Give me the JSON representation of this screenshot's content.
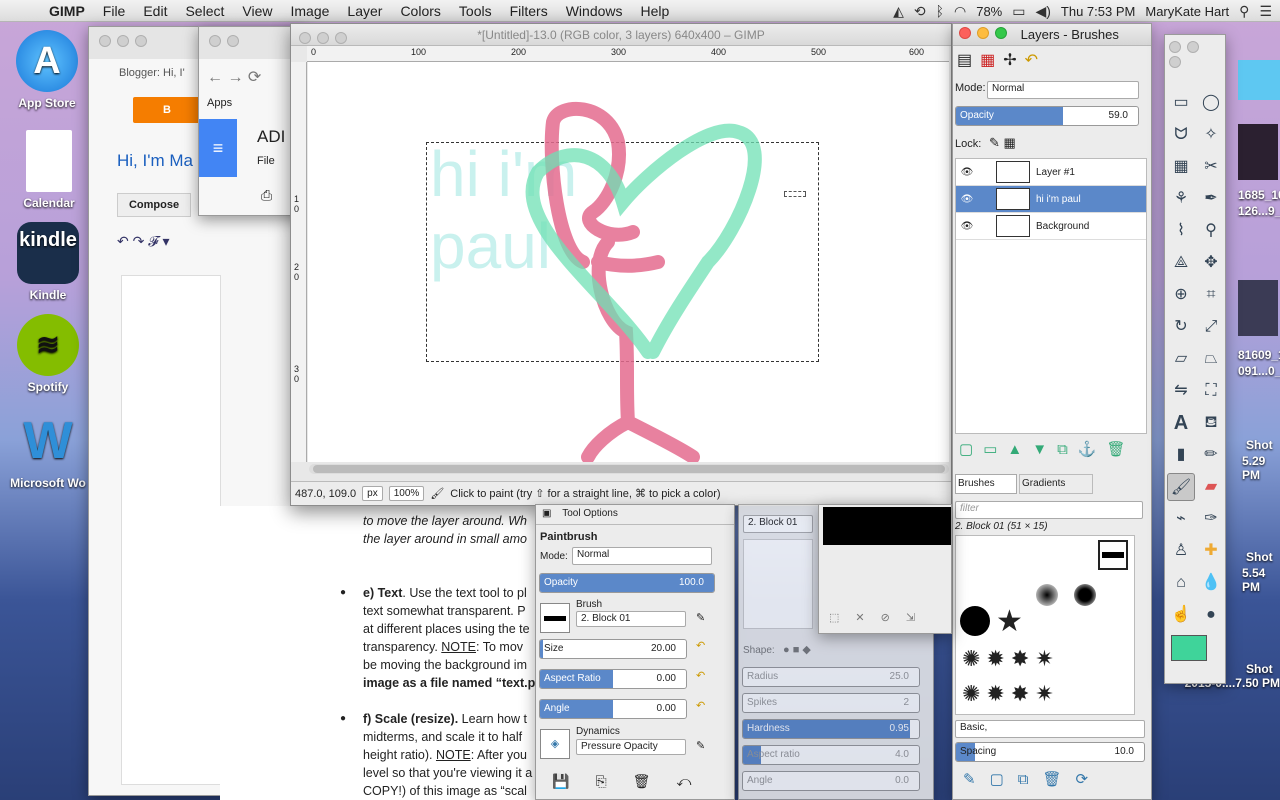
{
  "menubar": {
    "app": "GIMP",
    "items": [
      "File",
      "Edit",
      "Select",
      "View",
      "Image",
      "Layer",
      "Colors",
      "Tools",
      "Filters",
      "Windows",
      "Help"
    ],
    "battery": "78%",
    "clock": "Thu 7:53 PM",
    "user": "MaryKate Hart"
  },
  "desktop": {
    "icons": [
      {
        "label": "App Store"
      },
      {
        "label": "Calendar"
      },
      {
        "label": "Kindle"
      },
      {
        "label": "Spotify"
      },
      {
        "label": "Microsoft Wo"
      }
    ],
    "right_labels": [
      "1685_102",
      "126...9_n",
      "81609_10",
      "091...0_n",
      "Shot",
      "5.29 PM",
      "Shot",
      "5.54 PM",
      "Shot",
      "2015-0....7.50 PM",
      "PM",
      "PM",
      "PM",
      "PM"
    ]
  },
  "browser": {
    "tab_blogger": "Blogger: Hi, I'",
    "greeting": "Hi, I'm Ma",
    "compose": "Compose",
    "apps": "Apps",
    "doc_title": "ADI",
    "doc_menu_file": "File"
  },
  "gimp": {
    "title": "*[Untitled]-13.0 (RGB color, 3 layers) 640x400 – GIMP",
    "ruler_h": [
      "0",
      "100",
      "200",
      "300",
      "400",
      "500",
      "600"
    ],
    "ruler_v": [
      "0",
      "1",
      "0",
      "2",
      "0",
      "3",
      "0"
    ],
    "canvas_text": [
      "hi i'm",
      "paul"
    ],
    "status": {
      "coords": "487.0, 109.0",
      "unit": "px",
      "zoom": "100%",
      "hint": "Click to paint (try ⇧ for a straight line, ⌘ to pick a color)"
    }
  },
  "layers": {
    "title": "Layers - Brushes",
    "mode_label": "Mode:",
    "mode": "Normal",
    "opacity_label": "Opacity",
    "opacity": "59.0",
    "lock": "Lock:",
    "rows": [
      {
        "name": "Layer #1"
      },
      {
        "name": "hi i'm paul"
      },
      {
        "name": "Background"
      }
    ]
  },
  "brushes": {
    "tab1": "Brushes",
    "tab2": "Gradients",
    "filter": "filter",
    "current": "2. Block 01 (51 × 15)",
    "preset": "Basic,",
    "spacing_label": "Spacing",
    "spacing": "10.0"
  },
  "tool_options": {
    "title": "Tool Options",
    "tool": "Paintbrush",
    "mode_label": "Mode:",
    "mode": "Normal",
    "opacity_label": "Opacity",
    "opacity": "100.0",
    "brush_label": "Brush",
    "brush": "2. Block 01",
    "size_label": "Size",
    "size": "20.00",
    "aspect_label": "Aspect Ratio",
    "aspect": "0.00",
    "angle_label": "Angle",
    "angle": "0.00",
    "dynamics_label": "Dynamics",
    "dynamics": "Pressure Opacity"
  },
  "brush_editor": {
    "name": "2. Block 01",
    "shape": "Shape:",
    "radius_label": "Radius",
    "radius": "25.0",
    "spikes_label": "Spikes",
    "spikes": "2",
    "hardness_label": "Hardness",
    "hardness": "0.95",
    "aspect_label": "Aspect ratio",
    "aspect": "4.0",
    "angle_label": "Angle",
    "angle": "0.0"
  },
  "doc_text": {
    "l1": "to move the layer around. Wh",
    "l2": "the layer around in small amo",
    "e_head": "e) Text",
    "e_body": [
      ". Use the text tool to pl",
      "text somewhat transparent. P",
      "at different places using the te",
      "transparency. ",
      "be moving the background im",
      "image as a file named “text.p"
    ],
    "note": "NOTE",
    "note2": ": To mov",
    "f_head": "f) Scale (resize).",
    "f_body": [
      " Learn how t",
      "midterms, and scale it to half",
      "height ratio). ",
      "level so that you're viewing it a",
      "COPY!) of this image as “scal"
    ],
    "note3": ": After you"
  },
  "colors": {
    "fg": "#3fd49a",
    "bg": "#ffffff",
    "accent": "#5b88c9",
    "heart": "#6fe0b4",
    "stick": "#e46b8e"
  }
}
